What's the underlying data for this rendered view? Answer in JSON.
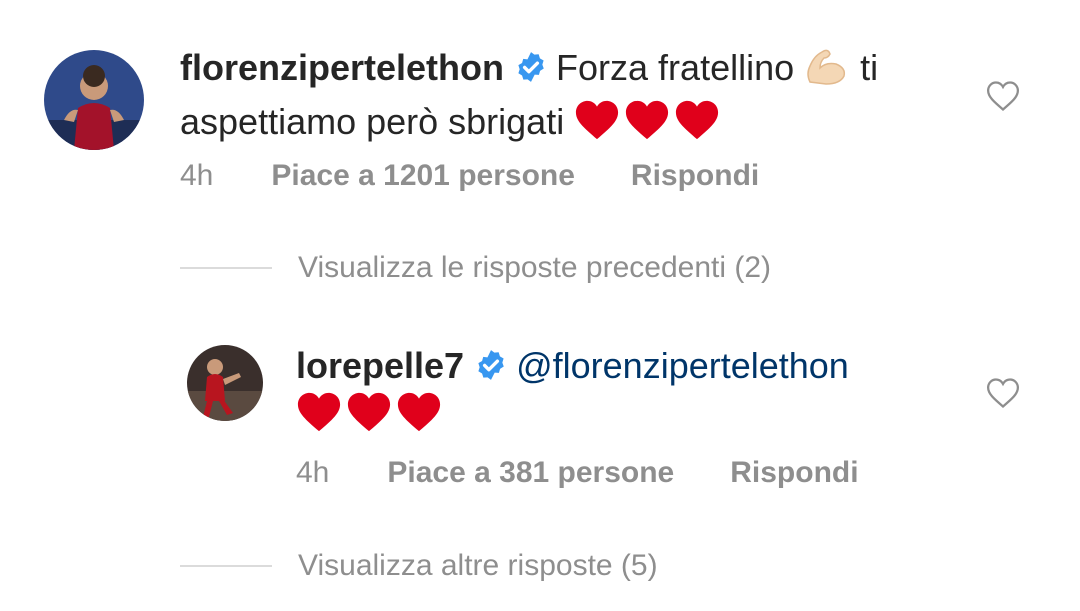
{
  "comments": [
    {
      "username": "florenzipertelethon",
      "text": "Forza fratellino",
      "emoji_icon": "flexed-biceps-icon",
      "text_cont": "ti",
      "text_line2": "aspettiamo però sbrigati",
      "hearts": 3,
      "time": "4h",
      "likes": "Piace a 1201 persone",
      "reply": "Rispondi"
    },
    {
      "username": "lorepelle7",
      "mention": "@florenzipertelethon",
      "hearts": 3,
      "time": "4h",
      "likes": "Piace a 381 persone",
      "reply": "Rispondi"
    }
  ],
  "view_previous": "Visualizza le risposte precedenti (2)",
  "view_more": "Visualizza altre risposte (5)",
  "colors": {
    "text": "#262626",
    "secondary": "#8e8e8e",
    "mention": "#003569",
    "verified": "#3897f0",
    "heart": "#e0001b"
  }
}
